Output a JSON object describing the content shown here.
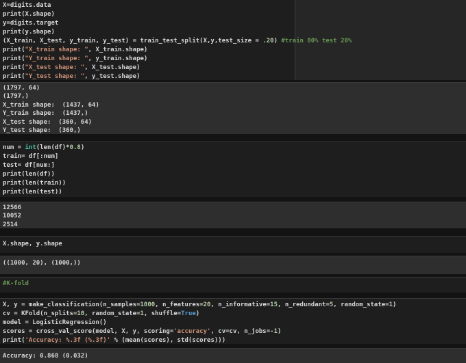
{
  "palette": {
    "code_bg": "#1e1e1e",
    "output_bg": "#2e2e2e",
    "gap_bg": "#131313",
    "right_panel_bg": "#262626",
    "text": "#d8d8d8",
    "output_text": "#d0d0d0",
    "string": "#ce9178",
    "comment": "#6a9955",
    "number": "#b5cea8",
    "keyword": "#569cd6",
    "builtin": "#4ec9b0"
  },
  "cells": [
    {
      "name": "code-cell-train-test-split",
      "kind": "code",
      "lines": [
        [
          [
            "X=digits.data"
          ]
        ],
        [
          [
            "print(X.shape)"
          ]
        ],
        [
          [
            "y=digits.target"
          ]
        ],
        [
          [
            "print(y.shape)"
          ]
        ],
        [
          [
            "(X_train, X_test, y_train, y_test) = train_test_split(X,y,test_size = "
          ],
          [
            ".20",
            "num"
          ],
          [
            ") "
          ],
          [
            "#train 80% test 20%",
            "comment"
          ]
        ],
        [
          [
            "print("
          ],
          [
            "\"X_train shape: \"",
            "str"
          ],
          [
            ", X_train.shape)"
          ]
        ],
        [
          [
            "print("
          ],
          [
            "\"Y_train shape: \"",
            "str"
          ],
          [
            ", y_train.shape)"
          ]
        ],
        [
          [
            "print("
          ],
          [
            "\"X_test shape: \"",
            "str"
          ],
          [
            ", X_test.shape)"
          ]
        ],
        [
          [
            "print("
          ],
          [
            "\"Y_test shape: \"",
            "str"
          ],
          [
            ", y_test.shape)"
          ]
        ]
      ]
    },
    {
      "name": "output-train-test-split",
      "kind": "output",
      "lines": [
        [
          [
            "(1797, 64)"
          ]
        ],
        [
          [
            "(1797,)"
          ]
        ],
        [
          [
            "X_train shape:  (1437, 64)"
          ]
        ],
        [
          [
            "Y_train shape:  (1437,)"
          ]
        ],
        [
          [
            "X_test shape:  (360, 64)"
          ]
        ],
        [
          [
            "Y_test shape:  (360,)"
          ]
        ]
      ]
    },
    {
      "name": "code-cell-df-split",
      "kind": "code",
      "lines": [
        [
          [
            "num = "
          ],
          [
            "int",
            "type"
          ],
          [
            "(len(df)*"
          ],
          [
            "0.8",
            "num"
          ],
          [
            ")"
          ]
        ],
        [
          [
            "train= df[:num]"
          ]
        ],
        [
          [
            "test= df[num:]"
          ]
        ],
        [
          [
            "print(len(df))"
          ]
        ],
        [
          [
            "print(len(train))"
          ]
        ],
        [
          [
            "print(len(test))"
          ]
        ]
      ]
    },
    {
      "name": "output-df-split",
      "kind": "output",
      "lines": [
        [
          [
            "12566"
          ]
        ],
        [
          [
            "10052"
          ]
        ],
        [
          [
            "2514"
          ]
        ]
      ]
    },
    {
      "name": "code-cell-shape-inspect",
      "kind": "code",
      "lines": [
        [
          [
            "X.shape, y.shape"
          ]
        ]
      ]
    },
    {
      "name": "output-shape-inspect",
      "kind": "output",
      "lines": [
        [
          [
            "((1000, 20), (1000,))"
          ]
        ]
      ]
    },
    {
      "name": "code-cell-kfold-comment",
      "kind": "code",
      "lines": [
        [
          [
            "#K-fold",
            "comment"
          ]
        ]
      ]
    },
    {
      "name": "code-cell-kfold-cv",
      "kind": "code",
      "lines": [
        [
          [
            "X, y = make_classification(n_samples="
          ],
          [
            "1000",
            "num"
          ],
          [
            ", n_features="
          ],
          [
            "20",
            "num"
          ],
          [
            ", n_informative="
          ],
          [
            "15",
            "num"
          ],
          [
            ", n_redundant="
          ],
          [
            "5",
            "num"
          ],
          [
            ", random_state="
          ],
          [
            "1",
            "num"
          ],
          [
            ")"
          ]
        ],
        [
          [
            "cv = KFold(n_splits="
          ],
          [
            "10",
            "num"
          ],
          [
            ", random_state="
          ],
          [
            "1",
            "num"
          ],
          [
            ", shuffle="
          ],
          [
            "True",
            "kw"
          ],
          [
            ")"
          ]
        ],
        [
          [
            "model = LogisticRegression()"
          ]
        ],
        [
          [
            "scores = cross_val_score(model, X, y, scoring="
          ],
          [
            "'accuracy'",
            "str"
          ],
          [
            ", cv=cv, n_jobs=-"
          ],
          [
            "1",
            "num"
          ],
          [
            ")"
          ]
        ],
        [
          [
            "print("
          ],
          [
            "'Accuracy: %.3f (%.3f)'",
            "str"
          ],
          [
            " % (mean(scores), std(scores)))"
          ]
        ]
      ]
    },
    {
      "name": "output-kfold-accuracy",
      "kind": "output",
      "lines": [
        [
          [
            "Accuracy: 0.868 (0.032)"
          ]
        ]
      ]
    }
  ]
}
